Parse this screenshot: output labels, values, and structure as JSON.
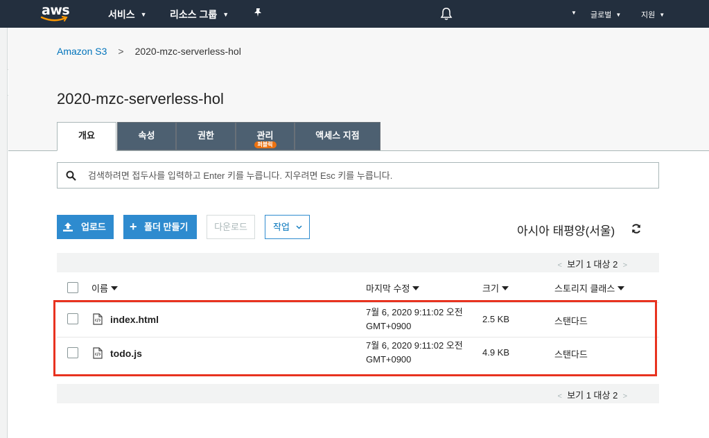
{
  "topnav": {
    "logo_text": "aws",
    "services": "서비스",
    "resource_groups": "리소스 그룹",
    "global": "글로벌",
    "support": "지원"
  },
  "breadcrumb": {
    "root": "Amazon S3",
    "separator": ">",
    "current": "2020-mzc-serverless-hol"
  },
  "page_title": "2020-mzc-serverless-hol",
  "tabs": [
    {
      "label": "개요",
      "active": true
    },
    {
      "label": "속성"
    },
    {
      "label": "권한"
    },
    {
      "label": "관리",
      "badge": "퍼블릭"
    },
    {
      "label": "액세스 지점"
    }
  ],
  "search": {
    "placeholder": "검색하려면 접두사를 입력하고 Enter 키를 누릅니다. 지우려면 Esc 키를 누릅니다."
  },
  "toolbar": {
    "upload": "업로드",
    "create_folder": "폴더 만들기",
    "download": "다운로드",
    "actions": "작업",
    "region": "아시아 태평양(서울)"
  },
  "pager": {
    "text": "보기 1 대상 2"
  },
  "table": {
    "columns": [
      "이름",
      "마지막 수정",
      "크기",
      "스토리지 클래스"
    ],
    "rows": [
      {
        "name": "index.html",
        "modified_line1": "7월 6, 2020 9:11:02 오전",
        "modified_line2": "GMT+0900",
        "size": "2.5 KB",
        "storage": "스탠다드"
      },
      {
        "name": "todo.js",
        "modified_line1": "7월 6, 2020 9:11:02 오전",
        "modified_line2": "GMT+0900",
        "size": "4.9 KB",
        "storage": "스탠다드"
      }
    ]
  },
  "colors": {
    "nav_bg": "#232f3e",
    "tab_bg": "#4d6071",
    "primary": "#2e8bcf",
    "link": "#0073bb",
    "badge": "#ec7211",
    "highlight": "#e8321f"
  }
}
